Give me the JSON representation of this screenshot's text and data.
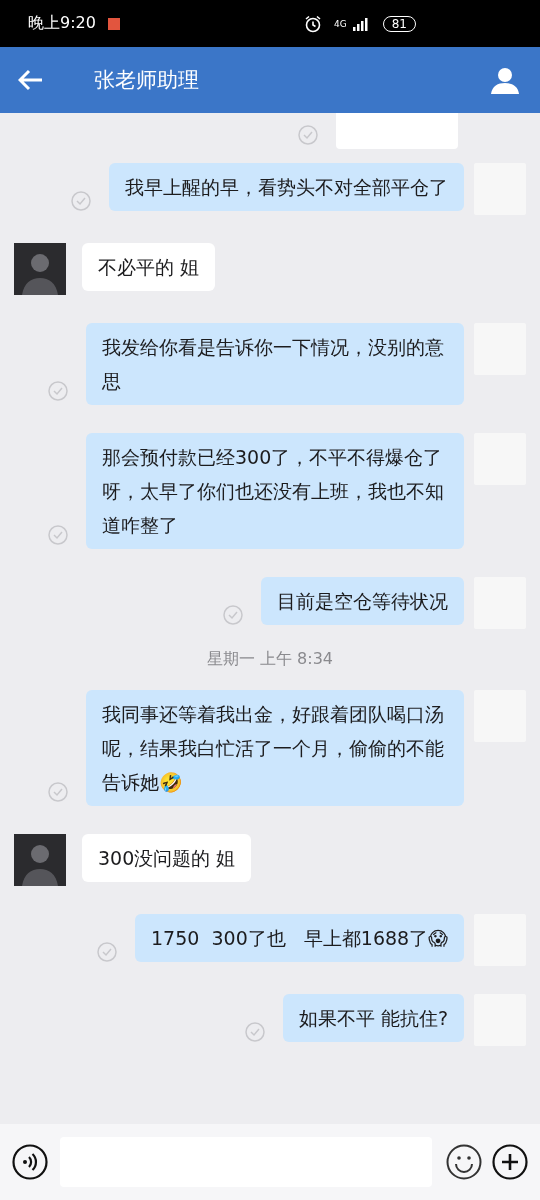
{
  "status_bar": {
    "time": "晚上9:20",
    "network": "4G",
    "battery": "81"
  },
  "header": {
    "title": "张老师助理"
  },
  "messages": [
    {
      "kind": "image"
    },
    {
      "kind": "sent",
      "text": "我早上醒的早，看势头不对全部平仓了"
    },
    {
      "kind": "received",
      "text": "不必平的 姐"
    },
    {
      "kind": "sent",
      "text": "我发给你看是告诉你一下情况，没别的意思"
    },
    {
      "kind": "sent",
      "text": "那会预付款已经300了，不平不得爆仓了呀，太早了你们也还没有上班，我也不知道咋整了"
    },
    {
      "kind": "sent",
      "text": "目前是空仓等待状况"
    },
    {
      "kind": "time",
      "text": "星期一 上午 8:34"
    },
    {
      "kind": "sent",
      "text": "我同事还等着我出金，好跟着团队喝口汤呢，结果我白忙活了一个月，偷偷的不能告诉她🤣"
    },
    {
      "kind": "received",
      "text": "300没问题的 姐"
    },
    {
      "kind": "sent",
      "text": "1750  300了也   早上都1688了😱"
    },
    {
      "kind": "sent",
      "text": "如果不平 能抗住?"
    }
  ]
}
